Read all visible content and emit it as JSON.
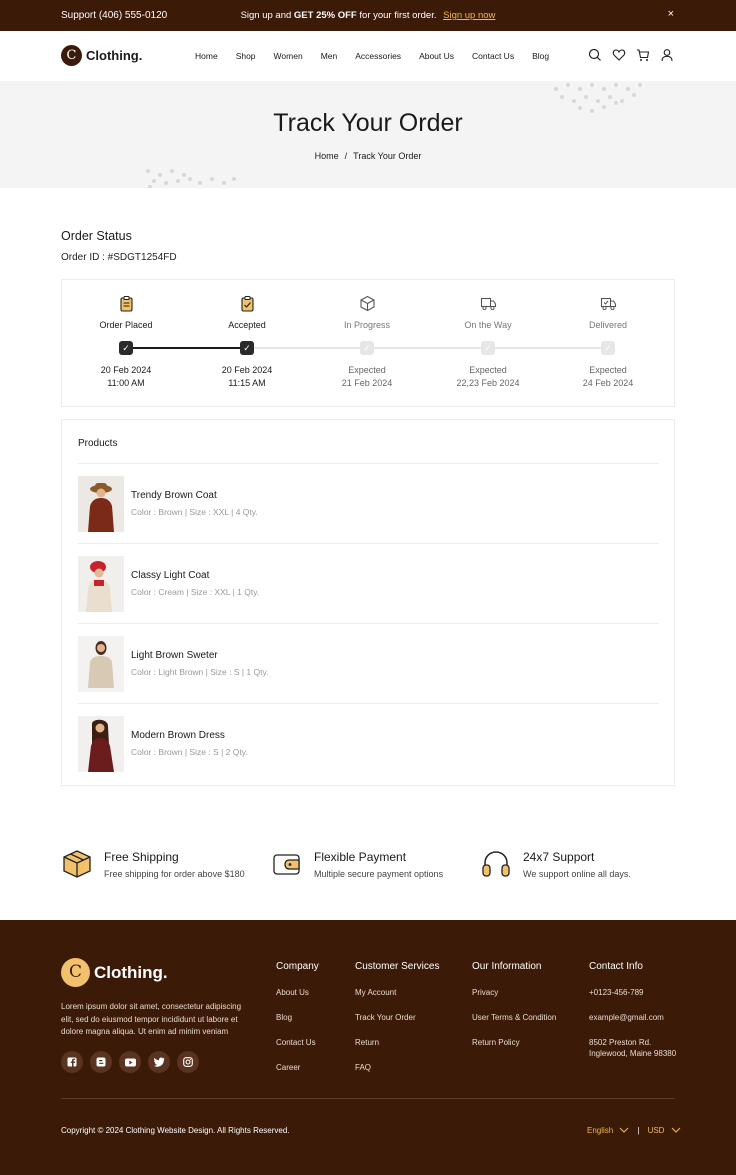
{
  "topbar": {
    "support_label": "Support",
    "support_phone": "(406) 555-0120",
    "promo_prefix": "Sign up and",
    "promo_bold": "GET 25% OFF",
    "promo_suffix": "for your first order.",
    "promo_link": "Sign up now",
    "close": "×"
  },
  "header": {
    "logo_letter": "C",
    "logo_text": "Clothing.",
    "nav": [
      "Home",
      "Shop",
      "Women",
      "Men",
      "Accessories",
      "About Us",
      "Contact Us",
      "Blog"
    ],
    "icons": [
      "search-icon",
      "heart-icon",
      "cart-icon",
      "user-icon"
    ]
  },
  "hero": {
    "title": "Track Your Order",
    "breadcrumb_home": "Home",
    "breadcrumb_sep": "/",
    "breadcrumb_current": "Track Your Order"
  },
  "order": {
    "title": "Order Status",
    "id_label": "Order ID : #SDGT1254FD",
    "steps": [
      {
        "label": "Order Placed",
        "line1": "20 Feb 2024",
        "line2": "11:00 AM",
        "done": true,
        "icon": "clipboard-icon"
      },
      {
        "label": "Accepted",
        "line1": "20 Feb 2024",
        "line2": "11:15 AM",
        "done": true,
        "icon": "clipboard-check-icon"
      },
      {
        "label": "In Progress",
        "line1": "Expected",
        "line2": "21 Feb 2024",
        "done": false,
        "icon": "box-icon"
      },
      {
        "label": "On the Way",
        "line1": "Expected",
        "line2": "22,23 Feb 2024",
        "done": false,
        "icon": "truck-icon"
      },
      {
        "label": "Delivered",
        "line1": "Expected",
        "line2": "24 Feb 2024",
        "done": false,
        "icon": "delivery-truck-icon"
      }
    ],
    "check": "✓"
  },
  "products": {
    "title": "Products",
    "items": [
      {
        "name": "Trendy Brown Coat",
        "meta": "Color : Brown | Size : XXL | 4 Qty."
      },
      {
        "name": "Classy Light Coat",
        "meta": "Color : Cream | Size : XXL | 1 Qty."
      },
      {
        "name": "Light Brown Sweter",
        "meta": "Color : Light Brown | Size : S | 1 Qty."
      },
      {
        "name": "Modern Brown Dress",
        "meta": "Color :  Brown | Size : S | 2 Qty."
      }
    ]
  },
  "features": [
    {
      "title": "Free Shipping",
      "desc": "Free shipping for order above $180",
      "icon": "package-icon"
    },
    {
      "title": "Flexible Payment",
      "desc": "Multiple secure payment options",
      "icon": "wallet-icon"
    },
    {
      "title": "24x7 Support",
      "desc": "We support online all days.",
      "icon": "headphones-icon"
    }
  ],
  "footer": {
    "logo_letter": "C",
    "logo_text": "Clothing.",
    "description": "Lorem ipsum dolor sit amet, consectetur adipiscing elit, sed do eiusmod tempor incididunt ut labore et dolore magna aliqua. Ut enim ad minim veniam",
    "socials": [
      "facebook-icon",
      "blogger-icon",
      "youtube-icon",
      "twitter-icon",
      "instagram-icon"
    ],
    "columns": [
      {
        "title": "Company",
        "links": [
          "About Us",
          "Blog",
          "Contact Us",
          "Career"
        ]
      },
      {
        "title": "Customer Services",
        "links": [
          "My Account",
          "Track Your Order",
          "Return",
          "FAQ"
        ]
      },
      {
        "title": "Our Information",
        "links": [
          "Privacy",
          "User Terms & Condition",
          "Return Policy"
        ]
      },
      {
        "title": "Contact Info",
        "links": [
          "+0123-456-789",
          "example@gmail.com",
          "8502 Preston Rd. Inglewood, Maine 98380"
        ]
      }
    ],
    "copyright": "Copyright © 2024 Clothing Website Design. All Rights Reserved.",
    "language": "English",
    "currency": "USD",
    "divider": "|"
  },
  "colors": {
    "brand_dark": "#3b1a07",
    "accent": "#f2b94a",
    "accent_soft": "#f2c16b"
  }
}
